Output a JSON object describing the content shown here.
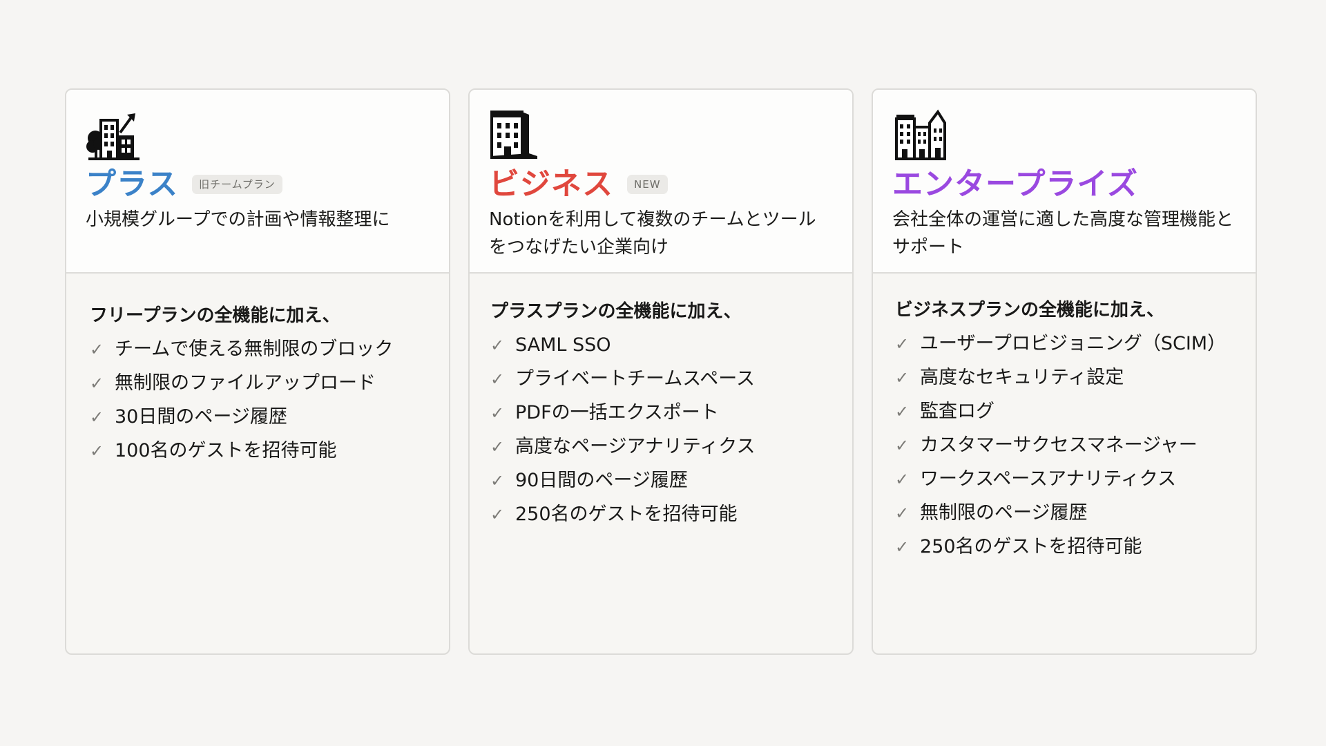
{
  "plans": [
    {
      "id": "plus",
      "name": "プラス",
      "name_color": "#3b82c8",
      "badge": "旧チームプラン",
      "icon": "building-with-tree-and-arrow-icon",
      "description": "小規模グループでの計画や情報整理に",
      "features_heading": "フリープランの全機能に加え、",
      "features": [
        "チームで使える無制限のブロック",
        "無制限のファイルアップロード",
        "30日間のページ履歴",
        "100名のゲストを招待可能"
      ]
    },
    {
      "id": "business",
      "name": "ビジネス",
      "name_color": "#e0473d",
      "badge": "NEW",
      "icon": "office-building-icon",
      "description": "Notionを利用して複数のチームとツールをつなげたい企業向け",
      "features_heading": "プラスプランの全機能に加え、",
      "features": [
        "SAML SSO",
        "プライベートチームスペース",
        "PDFの一括エクスポート",
        "高度なページアナリティクス",
        "90日間のページ履歴",
        "250名のゲストを招待可能"
      ]
    },
    {
      "id": "enterprise",
      "name": "エンタープライズ",
      "name_color": "#9a49e0",
      "badge": "",
      "icon": "city-buildings-icon",
      "description": "会社全体の運営に適した高度な管理機能とサポート",
      "features_heading": "ビジネスプランの全機能に加え、",
      "features": [
        "ユーザープロビジョニング（SCIM）",
        "高度なセキュリティ設定",
        "監査ログ",
        "カスタマーサクセスマネージャー",
        "ワークスペースアナリティクス",
        "無制限のページ履歴",
        "250名のゲストを招待可能"
      ]
    }
  ],
  "check_glyph": "✓"
}
